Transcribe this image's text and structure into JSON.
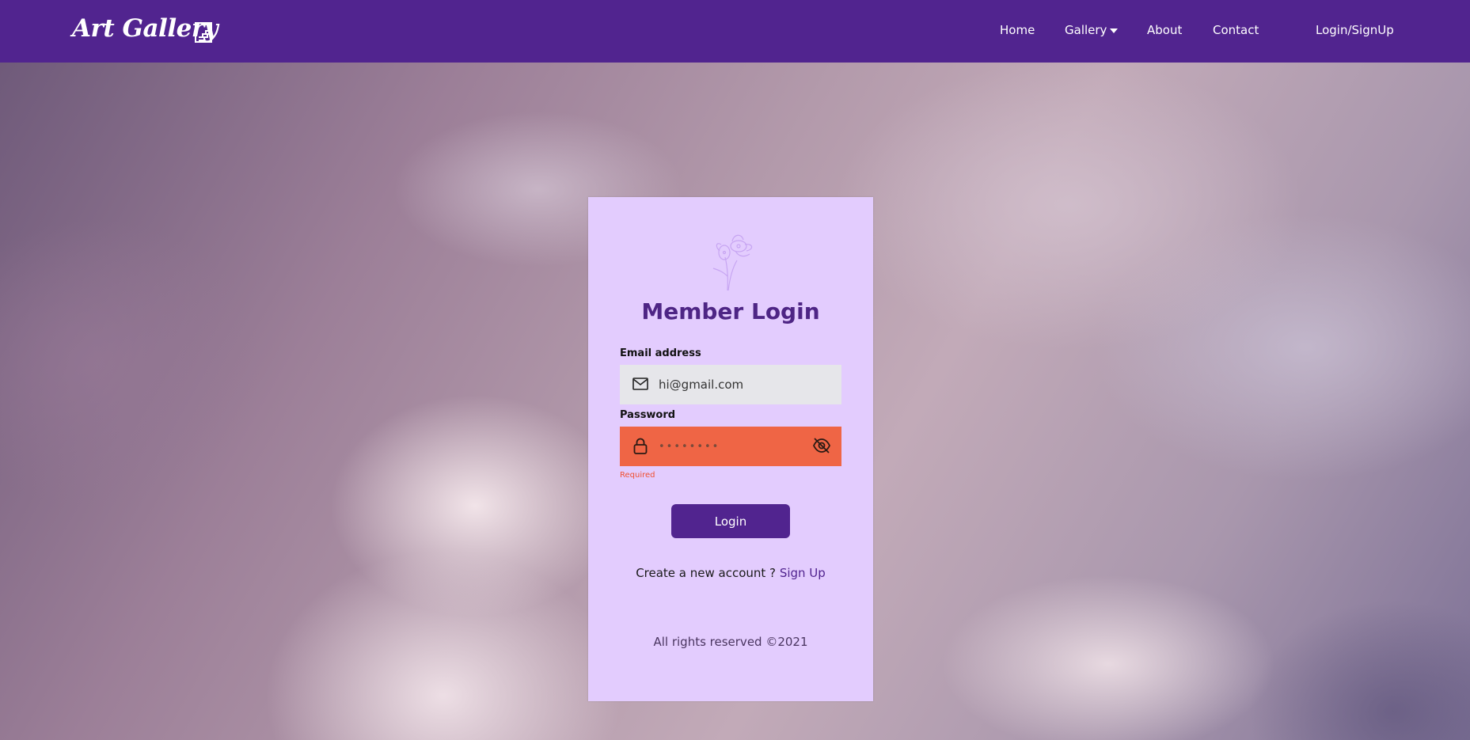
{
  "nav": {
    "brand": "Art Gallery",
    "links": {
      "home": "Home",
      "gallery": "Gallery",
      "about": "About",
      "contact": "Contact",
      "login_signup": "Login/SignUp"
    }
  },
  "login": {
    "title": "Member Login",
    "email_label": "Email address",
    "email_value": "hi@gmail.com",
    "email_icon": "mail-icon",
    "password_label": "Password",
    "password_value": "••••••••",
    "password_icon": "lock-icon",
    "password_toggle_icon": "eye-off-icon",
    "password_error": "Required",
    "button_label": "Login",
    "signup_prompt": "Create a new account ?",
    "signup_link": "Sign Up",
    "footer": "All rights reserved ©2021"
  },
  "colors": {
    "navbar": "#51248f",
    "card": "#e3ccfe",
    "error_field": "#ef6545",
    "error_text": "#f04f2f",
    "button": "#51248f"
  }
}
